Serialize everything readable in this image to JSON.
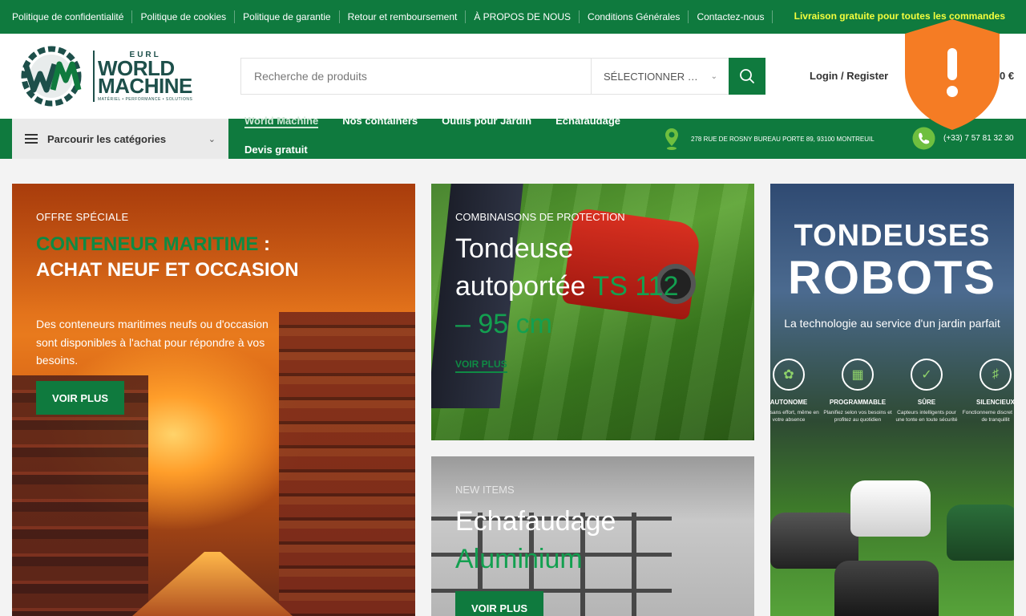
{
  "topbar": {
    "links": [
      "Politique de confidentialité",
      "Politique de cookies",
      "Politique de garantie",
      "Retour et remboursement",
      "À PROPOS DE NOUS",
      "Conditions Générales",
      "Contactez-nous"
    ],
    "promo": "Livraison gratuite pour toutes les commandes"
  },
  "logo": {
    "eurl": "EURL",
    "line1": "WORLD",
    "line2": "MACHINE",
    "tagline": "MATÉRIEL • PERFORMANCE • SOLUTIONS"
  },
  "search": {
    "placeholder": "Recherche de produits",
    "category_select": "SÉLECTIONNER …"
  },
  "header": {
    "login": "Login / Register",
    "cart_amount": "0 €"
  },
  "nav": {
    "categories_label": "Parcourir les catégories",
    "links": [
      "World Machine",
      "Nos containers",
      "Outils pour Jardin",
      "Echafaudage",
      "Devis gratuit"
    ],
    "address": "278 RUE DE ROSNY BUREAU PORTE 89, 93100 MONTREUIL",
    "phone": "(+33) 7 57 81 32 30"
  },
  "banners": {
    "container": {
      "kicker": "OFFRE SPÉCIALE",
      "title_green": "CONTENEUR MARITIME",
      "title_rest": " : ACHAT NEUF ET OCCASION",
      "description": "Des conteneurs maritimes neufs ou d'occasion sont disponibles à l'achat pour répondre à vos besoins.",
      "button": "VOIR PLUS"
    },
    "mower": {
      "kicker": "COMBINAISONS DE PROTECTION",
      "title_white": "Tondeuse autoportée ",
      "title_green": "TS 112 – 95 cm",
      "link": "VOIR PLUS"
    },
    "scaffold": {
      "kicker": "NEW ITEMS",
      "title_white": "Echafaudage ",
      "title_green": "Aluminium",
      "button": "VOIR PLUS"
    },
    "robots": {
      "heading1": "TONDEUSES",
      "heading2": "ROBOTS",
      "subtitle": "La technologie au service d'un jardin parfait",
      "features": [
        {
          "title": "AUTONOME",
          "desc": "onte sans effort, même en votre absence"
        },
        {
          "title": "PROGRAMMABLE",
          "desc": "Planifiez selon vos besoins et profitez au quotidien"
        },
        {
          "title": "SÛRE",
          "desc": "Capteurs intelligents pour une tonte en toute sécurité"
        },
        {
          "title": "SILENCIEUX",
          "desc": "Fonctionneme discret pour p de tranquillit"
        }
      ]
    }
  },
  "colors": {
    "brand_green": "#0f7a3e",
    "promo_yellow": "#f5ff3d",
    "shield_orange": "#f57c24"
  }
}
